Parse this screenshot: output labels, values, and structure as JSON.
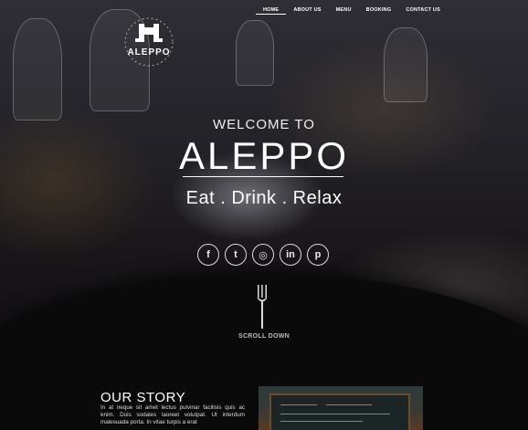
{
  "brand": {
    "logo_text": "ALEPPO"
  },
  "nav": {
    "items": [
      {
        "label": "HOME"
      },
      {
        "label": "ABOUT US"
      },
      {
        "label": "MENU"
      },
      {
        "label": "BOOKING"
      },
      {
        "label": "CONTACT US"
      }
    ]
  },
  "hero": {
    "welcome": "WELCOME TO",
    "title": "ALEPPO",
    "tagline": "Eat . Drink . Relax",
    "social": [
      {
        "icon": "facebook-icon",
        "glyph": "f"
      },
      {
        "icon": "twitter-icon",
        "glyph": "t"
      },
      {
        "icon": "instagram-icon",
        "glyph": "◎"
      },
      {
        "icon": "linkedin-icon",
        "glyph": "in"
      },
      {
        "icon": "pinterest-icon",
        "glyph": "p"
      }
    ],
    "scroll_label": "SCROLL DOWN"
  },
  "story": {
    "title": "OUR STORY",
    "text": "In at neque sit amet lectus pulvinar facilisis quis ac enim. Duis sodales laoreet volutpat. Ut interdum malesuada porta. In vitae turpis a erat"
  }
}
